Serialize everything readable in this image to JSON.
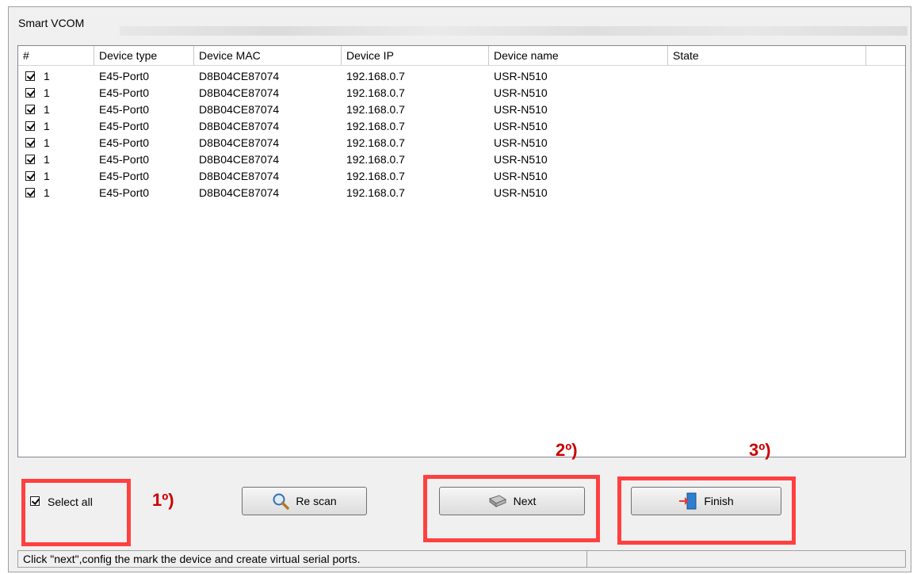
{
  "window": {
    "title": "Smart VCOM"
  },
  "table": {
    "columns": [
      "#",
      "Device type",
      "Device MAC",
      "Device IP",
      "Device name",
      "State"
    ],
    "rows": [
      {
        "checked": true,
        "num": "1",
        "type": "E45-Port0",
        "mac": "D8B04CE87074",
        "ip": "192.168.0.7",
        "name": "USR-N510",
        "state": ""
      },
      {
        "checked": true,
        "num": "1",
        "type": "E45-Port0",
        "mac": "D8B04CE87074",
        "ip": "192.168.0.7",
        "name": "USR-N510",
        "state": ""
      },
      {
        "checked": true,
        "num": "1",
        "type": "E45-Port0",
        "mac": "D8B04CE87074",
        "ip": "192.168.0.7",
        "name": "USR-N510",
        "state": ""
      },
      {
        "checked": true,
        "num": "1",
        "type": "E45-Port0",
        "mac": "D8B04CE87074",
        "ip": "192.168.0.7",
        "name": "USR-N510",
        "state": ""
      },
      {
        "checked": true,
        "num": "1",
        "type": "E45-Port0",
        "mac": "D8B04CE87074",
        "ip": "192.168.0.7",
        "name": "USR-N510",
        "state": ""
      },
      {
        "checked": true,
        "num": "1",
        "type": "E45-Port0",
        "mac": "D8B04CE87074",
        "ip": "192.168.0.7",
        "name": "USR-N510",
        "state": ""
      },
      {
        "checked": true,
        "num": "1",
        "type": "E45-Port0",
        "mac": "D8B04CE87074",
        "ip": "192.168.0.7",
        "name": "USR-N510",
        "state": ""
      },
      {
        "checked": true,
        "num": "1",
        "type": "E45-Port0",
        "mac": "D8B04CE87074",
        "ip": "192.168.0.7",
        "name": "USR-N510",
        "state": ""
      }
    ]
  },
  "controls": {
    "select_all": {
      "label": "Select all",
      "checked": true
    },
    "rescan_label": "Re scan",
    "next_label": "Next",
    "finish_label": "Finish"
  },
  "annotations": {
    "step1": "1º)",
    "step2": "2º)",
    "step3": "3º)",
    "highlight_color": "#ff4040"
  },
  "statusbar": {
    "text": "Click \"next\",config the mark the device and create virtual serial ports."
  },
  "icons": {
    "rescan": "magnifier-icon",
    "next": "network-device-icon",
    "finish": "exit-door-icon"
  }
}
